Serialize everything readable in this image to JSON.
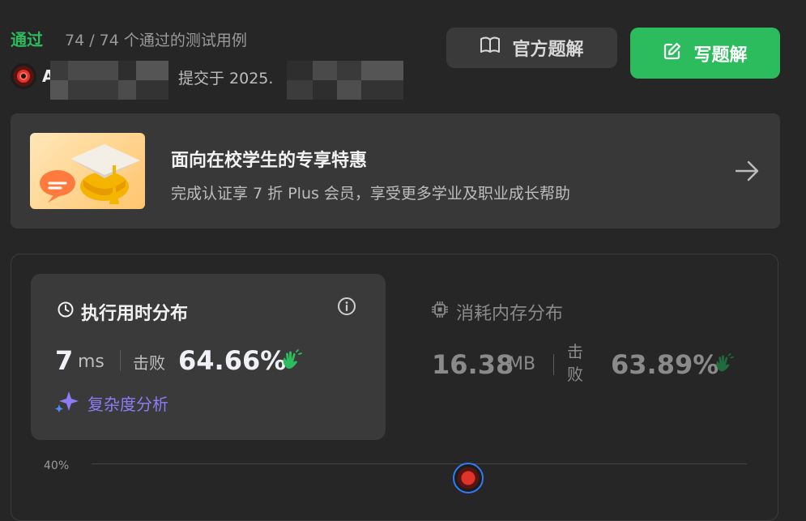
{
  "result": {
    "status": "通过",
    "cases_text": "74 / 74 个通过的测试用例"
  },
  "submitter": {
    "name_initial": "A",
    "submitted_prefix": "提交于 2025."
  },
  "buttons": {
    "official_solution": "官方题解",
    "write_solution": "写题解"
  },
  "promo": {
    "title": "面向在校学生的专享特惠",
    "description": "完成认证享 7 折 Plus 会员，享受更多学业及职业成长帮助"
  },
  "runtime": {
    "title": "执行用时分布",
    "value": "7",
    "unit": "ms",
    "beat_label": "击败",
    "beat_percent": "64.66%",
    "analysis_label": "复杂度分析"
  },
  "memory": {
    "title": "消耗内存分布",
    "value": "16.38",
    "unit": "MB",
    "beat_label": "击败",
    "beat_percent": "63.89%"
  },
  "chart": {
    "ytick": "40%"
  },
  "colors": {
    "accent_green": "#2cbb5d",
    "analysis_purple": "#8b7cf6",
    "background": "#262626"
  },
  "icons": [
    "book-icon",
    "edit-icon",
    "arrow-right-icon",
    "clock-icon",
    "info-icon",
    "cpu-icon",
    "clap-icon",
    "sparkle-icon"
  ]
}
